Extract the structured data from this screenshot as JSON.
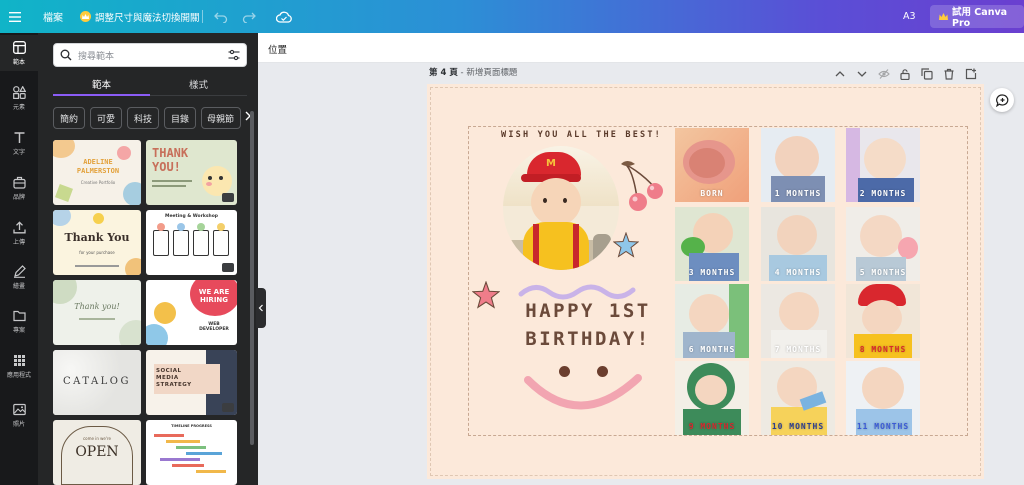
{
  "topbar": {
    "file_label": "檔案",
    "resize_label": "調整尺寸與魔法切換開關",
    "page_size": "A3",
    "pro_label": "試用 Canva Pro"
  },
  "rail": [
    {
      "label": "範本",
      "icon": "template-icon"
    },
    {
      "label": "元素",
      "icon": "elements-icon"
    },
    {
      "label": "文字",
      "icon": "text-icon"
    },
    {
      "label": "品牌",
      "icon": "brand-icon"
    },
    {
      "label": "上傳",
      "icon": "upload-icon"
    },
    {
      "label": "繪畫",
      "icon": "draw-icon"
    },
    {
      "label": "專案",
      "icon": "folder-icon"
    },
    {
      "label": "應用程式",
      "icon": "apps-icon"
    },
    {
      "label": "照片",
      "icon": "photo-icon"
    }
  ],
  "panel": {
    "search_placeholder": "搜尋範本",
    "tabs": [
      "範本",
      "樣式"
    ],
    "chips": [
      "簡約",
      "可愛",
      "科技",
      "目錄",
      "母親節"
    ],
    "templates": [
      {
        "title": "ADELINE PALMERSTON",
        "subtitle": "Creative Portfolio"
      },
      {
        "title": "THANK YOU!"
      },
      {
        "title": "Thank You",
        "subtitle": "for your purchase"
      },
      {
        "title": "Meeting & Workshop"
      },
      {
        "title": "Thank you!"
      },
      {
        "title": "WE ARE HIRING",
        "subtitle": "WEB DEVELOPER"
      },
      {
        "title": "CATALOG"
      },
      {
        "title": "SOCIAL MEDIA STRATEGY"
      },
      {
        "title": "OPEN",
        "subtitle": "come in we're"
      },
      {
        "title": "TIMELINE PROGRESS"
      }
    ]
  },
  "editor": {
    "position_label": "位置",
    "page_number": "第 4 頁",
    "page_title_placeholder": "新增頁面標題"
  },
  "design": {
    "wish_text": "WISH YOU ALL THE BEST!",
    "happy_line1": "HAPPY 1ST",
    "happy_line2": "BIRTHDAY!",
    "photos": [
      {
        "label": "BORN"
      },
      {
        "label": "1 MONTHS"
      },
      {
        "label": "2 MONTHS"
      },
      {
        "label": "3 MONTHS"
      },
      {
        "label": "4 MONTHS"
      },
      {
        "label": "5 MONTHS"
      },
      {
        "label": "6 MONTHS"
      },
      {
        "label": "7 MONTHS"
      },
      {
        "label": "8 MONTHS"
      },
      {
        "label": "9 MONTHS"
      },
      {
        "label": "10 MONTHS"
      },
      {
        "label": "11 MONTHS"
      }
    ]
  }
}
